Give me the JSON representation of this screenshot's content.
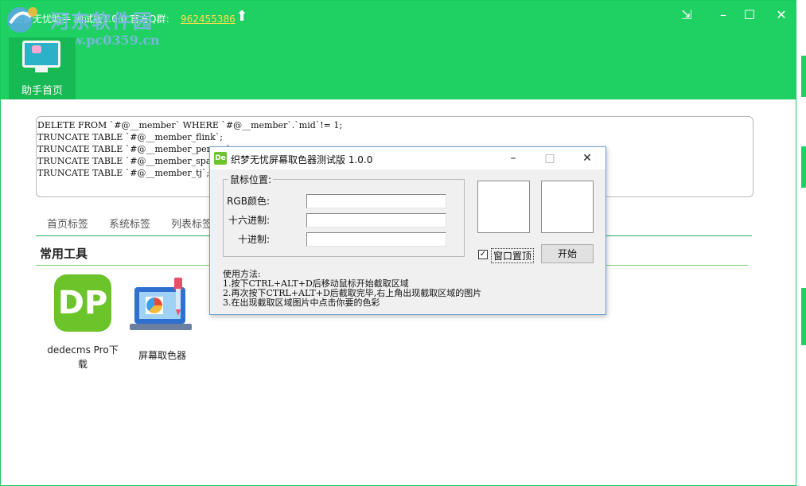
{
  "app": {
    "title": "织梦无忧助手 测试版1.0.0  官方Q群:",
    "qq_group": "962455386",
    "watermark": {
      "text": "河东软件园",
      "url": "www.pc0359.cn"
    },
    "nav": {
      "home_label": "助手首页"
    },
    "sql_lines": [
      "DELETE FROM `#@__member` WHERE `#@__member`.`mid`!= 1;",
      "TRUNCATE TABLE `#@__member_flink`;",
      "TRUNCATE TABLE `#@__member_person`;",
      "TRUNCATE TABLE `#@__member_space`;",
      "TRUNCATE TABLE `#@__member_tj`;"
    ],
    "tabs": [
      "首页标签",
      "系统标签",
      "列表标签"
    ],
    "section_title": "常用工具",
    "tools": [
      {
        "icon_text": "DP",
        "label": "dedecms Pro下载",
        "icon": "dedecms-pro-icon"
      },
      {
        "label": "屏幕取色器",
        "icon": "screen-color-picker-icon"
      }
    ],
    "window_controls": {
      "restore": "restore-icon",
      "maximize": "maximize-icon",
      "close": "close-icon"
    }
  },
  "dialog": {
    "icon_text": "De",
    "title": "织梦无忧屏幕取色器测试版 1.0.0",
    "group_label": "鼠标位置:",
    "fields": [
      {
        "label": "RGB颜色:",
        "value": ""
      },
      {
        "label": "十六进制:",
        "value": ""
      },
      {
        "label": "十进制:",
        "value": ""
      }
    ],
    "topmost_checkbox": {
      "label": "窗口置顶",
      "checked": true
    },
    "start_button": "开始",
    "usage_title": "使用方法:",
    "usage_steps": [
      "1.按下CTRL+ALT+D后移动鼠标开始截取区域",
      "2.再次按下CTRL+ALT+D后截取完毕,右上角出现截取区域的图片",
      "3.在出现截取区域图片中点击你要的色彩"
    ]
  },
  "colors": {
    "header_green": "#1fd162",
    "nav_active": "#17b954",
    "link_yellow": "#ffe04a",
    "dialog_border": "#6d9fd3"
  }
}
